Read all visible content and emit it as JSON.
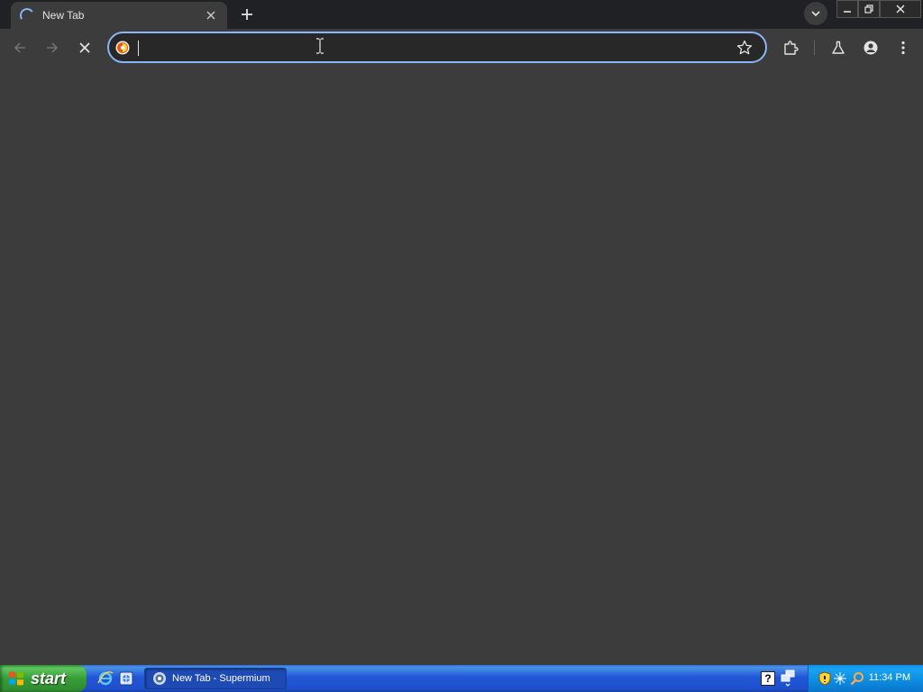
{
  "tab": {
    "title": "New Tab"
  },
  "omnibox": {
    "value": "",
    "placeholder": ""
  },
  "taskbar": {
    "start_label": "start",
    "window_button_label": "New Tab - Supermium",
    "clock": "11:34 PM"
  },
  "help_icon_glyph": "?",
  "colors": {
    "accent": "#8ab4f8",
    "tabstrip_bg": "#202124",
    "toolbar_bg": "#3c3c3c",
    "content_bg": "#3c3c3c",
    "taskbar_blue": "#2157d7",
    "start_green": "#379d37"
  }
}
